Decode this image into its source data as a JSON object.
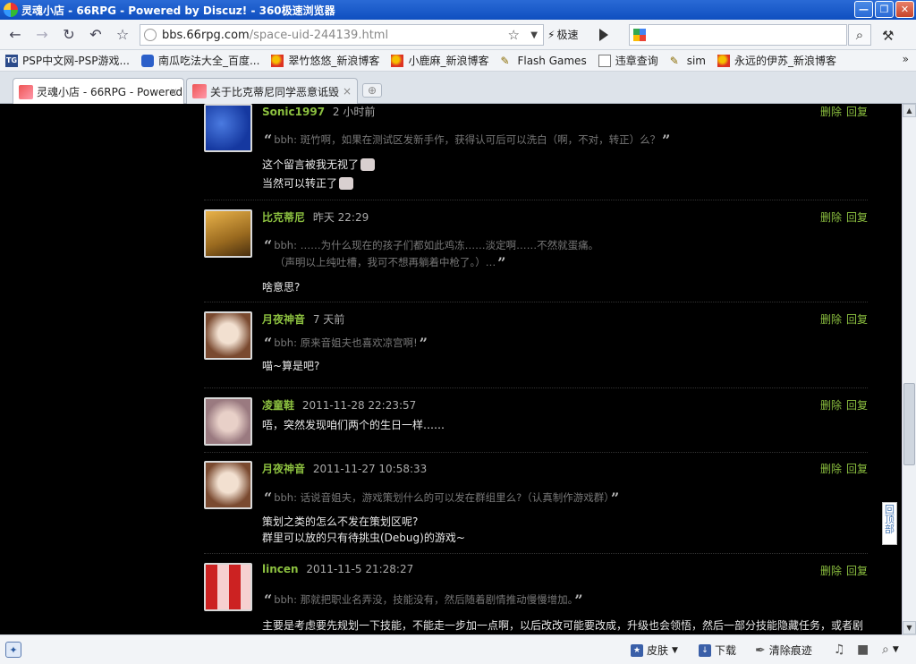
{
  "window": {
    "title": "灵魂小店 - 66RPG - Powered by Discuz! - 360极速浏览器",
    "controls": {
      "minimize": "—",
      "maximize": "❐",
      "close": "✕"
    }
  },
  "toolbar": {
    "url_host": "bbs.66rpg.com",
    "url_path": "/space-uid-244139.html",
    "speed_label": "极速",
    "search_value": ""
  },
  "bookmarks": [
    {
      "label": "PSP中文网-PSP游戏...",
      "icon": "tg-icon"
    },
    {
      "label": "南瓜吃法大全_百度...",
      "icon": "baidu-paw-icon"
    },
    {
      "label": "翠竹悠悠_新浪博客",
      "icon": "sina-icon"
    },
    {
      "label": "小鹿麻_新浪博客",
      "icon": "sina-icon"
    },
    {
      "label": "Flash Games",
      "icon": "flash-icon"
    },
    {
      "label": "违章查询",
      "icon": "page-icon"
    },
    {
      "label": "sim",
      "icon": "flash-icon"
    },
    {
      "label": "永远的伊苏_新浪博客",
      "icon": "sina-icon"
    }
  ],
  "bookmarks_more": "»",
  "tabs": [
    {
      "label": "灵魂小店 - 66RPG - Powered",
      "active": true
    },
    {
      "label": "关于比克蒂尼同学恶意诋毁",
      "active": false
    }
  ],
  "actions": {
    "delete": "删除",
    "reply": "回复"
  },
  "comments": [
    {
      "user": "Sonic1997",
      "time": "2 小时前",
      "quote_name": "bbh",
      "quote": ": 斑竹啊，如果在测试区发新手作，获得认可后可以洗白（啊，不对，转正）么？",
      "reply_lines": [
        "这个留言被我无视了",
        "当然可以转正了"
      ]
    },
    {
      "user": "比克蒂尼",
      "time": "昨天 22:29",
      "quote_name": "bbh",
      "quote": ": ……为什么现在的孩子们都如此鸡冻……淡定啊……不然就蛋痛。",
      "quote2": "（声明以上纯吐槽，我可不想再躺着中枪了。）…",
      "reply_lines": [
        "啥意思?"
      ]
    },
    {
      "user": "月夜神音",
      "time": "7 天前",
      "quote_name": "bbh",
      "quote": ": 原来音姐夫也喜欢凉宫啊!",
      "reply_lines": [
        "喵~算是吧?"
      ]
    },
    {
      "user": "凌童鞋",
      "time": "2011-11-28 22:23:57",
      "reply_lines": [
        "唔，突然发现咱们两个的生日一样……"
      ]
    },
    {
      "user": "月夜神音",
      "time": "2011-11-27 10:58:33",
      "quote_name": "bbh",
      "quote": ": 话说音姐夫，游戏策划什么的可以发在群组里么?（认真制作游戏群）",
      "reply_lines": [
        "策划之类的怎么不发在策划区呢?",
        "群里可以放的只有待挑虫(Debug)的游戏~"
      ]
    },
    {
      "user": "lincen",
      "time": "2011-11-5 21:28:27",
      "quote_name": "bbh",
      "quote": ": 那就把职业名弄没，技能没有，然后随着剧情推动慢慢增加。",
      "reply_lines": [
        "主要是考虑要先规划一下技能，不能走一步加一点啊，以后改改可能要改成，升级也会领悟，然后一部分技能隐藏任务，或者剧"
      ]
    }
  ],
  "back_to_top": "回顶部",
  "status": {
    "skin": "皮肤",
    "download": "下载",
    "clear": "清除痕迹"
  }
}
